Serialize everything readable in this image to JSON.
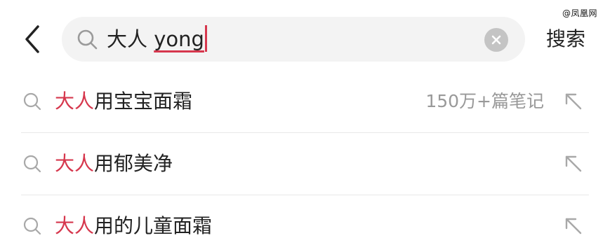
{
  "watermark": "@凤凰网",
  "search": {
    "query_prefix": "大人",
    "query_composing": "yong",
    "button_label": "搜索"
  },
  "icons": {
    "back": "chevron-left-icon",
    "search": "search-icon",
    "clear": "clear-icon",
    "fill": "arrow-up-left-icon"
  },
  "colors": {
    "highlight": "#d6374d",
    "search_bg": "#f3f3f3",
    "muted_text": "#999999"
  },
  "suggestions": [
    {
      "highlight": "大人",
      "rest": "用宝宝面霜",
      "count": "150万+篇笔记"
    },
    {
      "highlight": "大人",
      "rest": "用郁美净",
      "count": ""
    },
    {
      "highlight": "大人",
      "rest": "用的儿童面霜",
      "count": ""
    }
  ]
}
